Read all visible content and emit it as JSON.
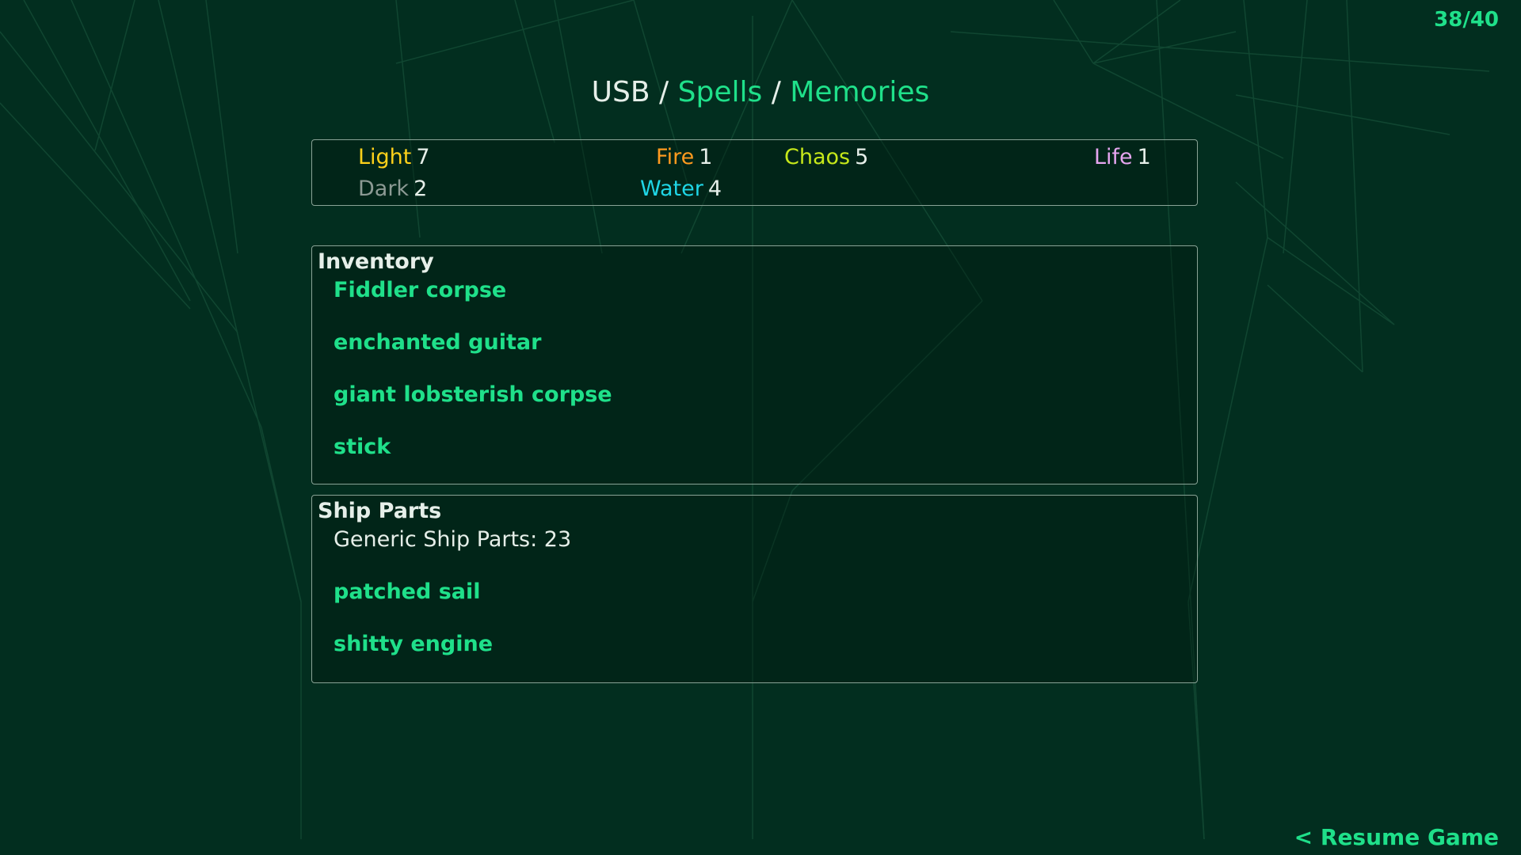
{
  "counter": "38/40",
  "breadcrumb": {
    "usb": "USB",
    "separator": "/",
    "spells": "Spells",
    "memories": "Memories"
  },
  "elements": [
    {
      "name": "Light",
      "value": "7",
      "color": "#ffd11a"
    },
    {
      "name": "Fire",
      "value": "1",
      "color": "#ff9a1f"
    },
    {
      "name": "Chaos",
      "value": "5",
      "color": "#c6e81a"
    },
    {
      "name": "Life",
      "value": "1",
      "color": "#e6a6f0"
    },
    {
      "name": "Dark",
      "value": "2",
      "color": "#8c9a94"
    },
    {
      "name": "Water",
      "value": "4",
      "color": "#1fd6e6"
    }
  ],
  "inventory": {
    "title": "Inventory",
    "items": [
      "Fiddler corpse",
      "enchanted guitar",
      "giant lobsterish corpse",
      "stick"
    ]
  },
  "ship_parts": {
    "title": "Ship Parts",
    "generic": "Generic Ship Parts: 23",
    "items": [
      "patched sail",
      "shitty engine"
    ]
  },
  "resume": "< Resume Game",
  "colors": {
    "background": "#022e1f",
    "accent": "#1fe08a",
    "text": "#e6efe9",
    "panel_border": "#8aa396"
  }
}
